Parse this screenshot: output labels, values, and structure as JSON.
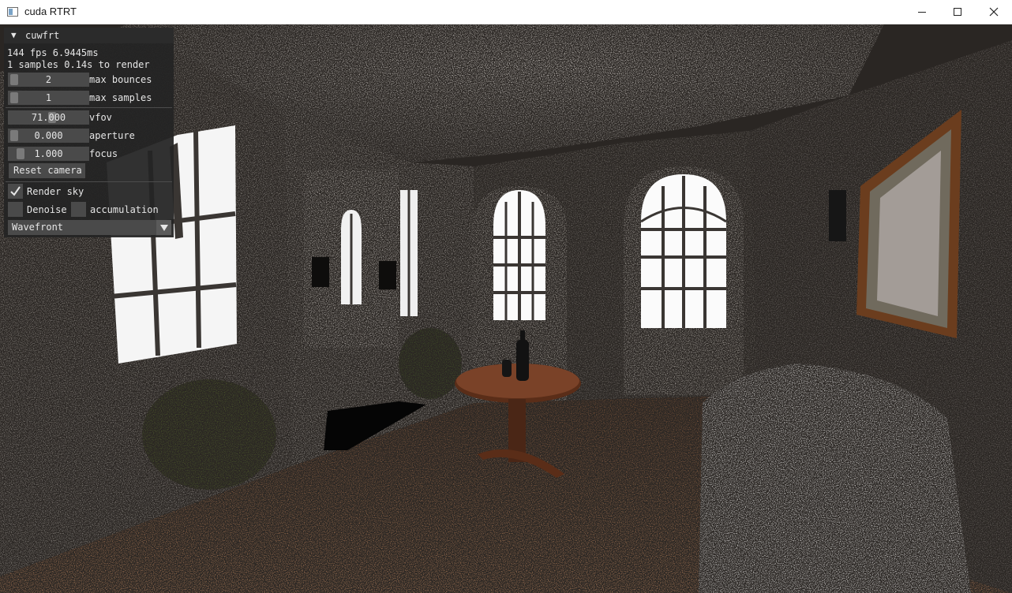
{
  "window": {
    "title": "cuda RTRT"
  },
  "panel": {
    "title": "cuwfrt",
    "stats_fps": "144 fps 6.9445ms",
    "stats_samples": "1 samples 0.14s to render",
    "sliders": [
      {
        "value": "2",
        "label": "max bounces"
      },
      {
        "value": "1",
        "label": "max samples"
      },
      {
        "value": "71.000",
        "label": "vfov"
      },
      {
        "value": "0.000",
        "label": "aperture"
      },
      {
        "value": "1.000",
        "label": "focus"
      }
    ],
    "reset_button": "Reset camera",
    "render_sky": {
      "label": "Render sky",
      "checked": true
    },
    "denoise": {
      "label": "Denoise",
      "checked": false
    },
    "accumulation": {
      "label": "accumulation",
      "checked": false
    },
    "renderer_select": {
      "value": "Wavefront"
    }
  },
  "colors": {
    "panel_bg": "#242424",
    "frame_bg": "#4a4a4a",
    "text": "#e6e6e6"
  }
}
